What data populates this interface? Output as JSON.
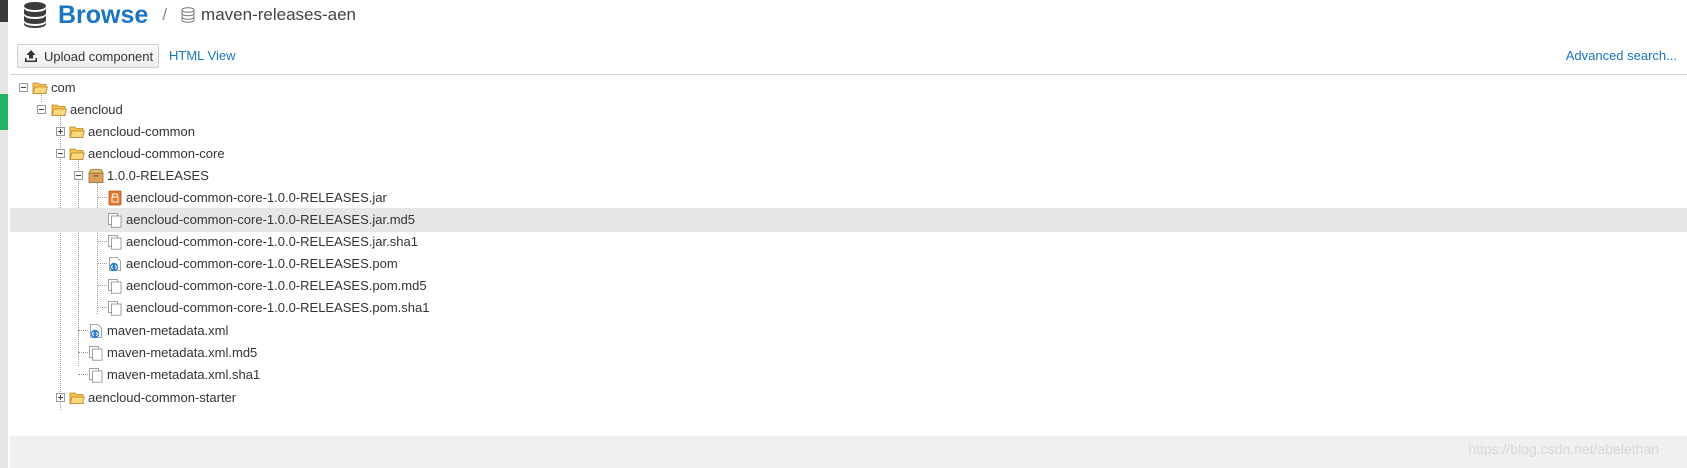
{
  "header": {
    "title": "Browse",
    "separator": "/",
    "repo_name": "maven-releases-aen",
    "title_icon": "database-icon",
    "repo_icon": "repository-icon"
  },
  "toolbar": {
    "upload_label": "Upload component",
    "upload_icon": "upload-icon",
    "html_view_label": "HTML View",
    "advanced_search_label": "Advanced search..."
  },
  "tree": {
    "items": [
      {
        "label": "com",
        "type": "folder",
        "state": "expanded"
      },
      {
        "label": "aencloud",
        "type": "folder",
        "state": "expanded"
      },
      {
        "label": "aencloud-common",
        "type": "folder",
        "state": "collapsed"
      },
      {
        "label": "aencloud-common-core",
        "type": "folder",
        "state": "expanded"
      },
      {
        "label": "1.0.0-RELEASES",
        "type": "component",
        "state": "expanded"
      },
      {
        "label": "aencloud-common-core-1.0.0-RELEASES.jar",
        "type": "jar"
      },
      {
        "label": "aencloud-common-core-1.0.0-RELEASES.jar.md5",
        "type": "file",
        "selected": true
      },
      {
        "label": "aencloud-common-core-1.0.0-RELEASES.jar.sha1",
        "type": "file"
      },
      {
        "label": "aencloud-common-core-1.0.0-RELEASES.pom",
        "type": "xml"
      },
      {
        "label": "aencloud-common-core-1.0.0-RELEASES.pom.md5",
        "type": "file"
      },
      {
        "label": "aencloud-common-core-1.0.0-RELEASES.pom.sha1",
        "type": "file"
      },
      {
        "label": "maven-metadata.xml",
        "type": "xml"
      },
      {
        "label": "maven-metadata.xml.md5",
        "type": "file"
      },
      {
        "label": "maven-metadata.xml.sha1",
        "type": "file"
      },
      {
        "label": "aencloud-common-starter",
        "type": "folder",
        "state": "collapsed"
      }
    ]
  },
  "watermark": "https://blog.csdn.net/abelethan",
  "colors": {
    "accent": "#1a75c4",
    "selected_row": "#e7e7e7",
    "status_green": "#23b569",
    "folder": "#f5c24b",
    "component": "#d9a25b",
    "jar": "#e8782a"
  }
}
